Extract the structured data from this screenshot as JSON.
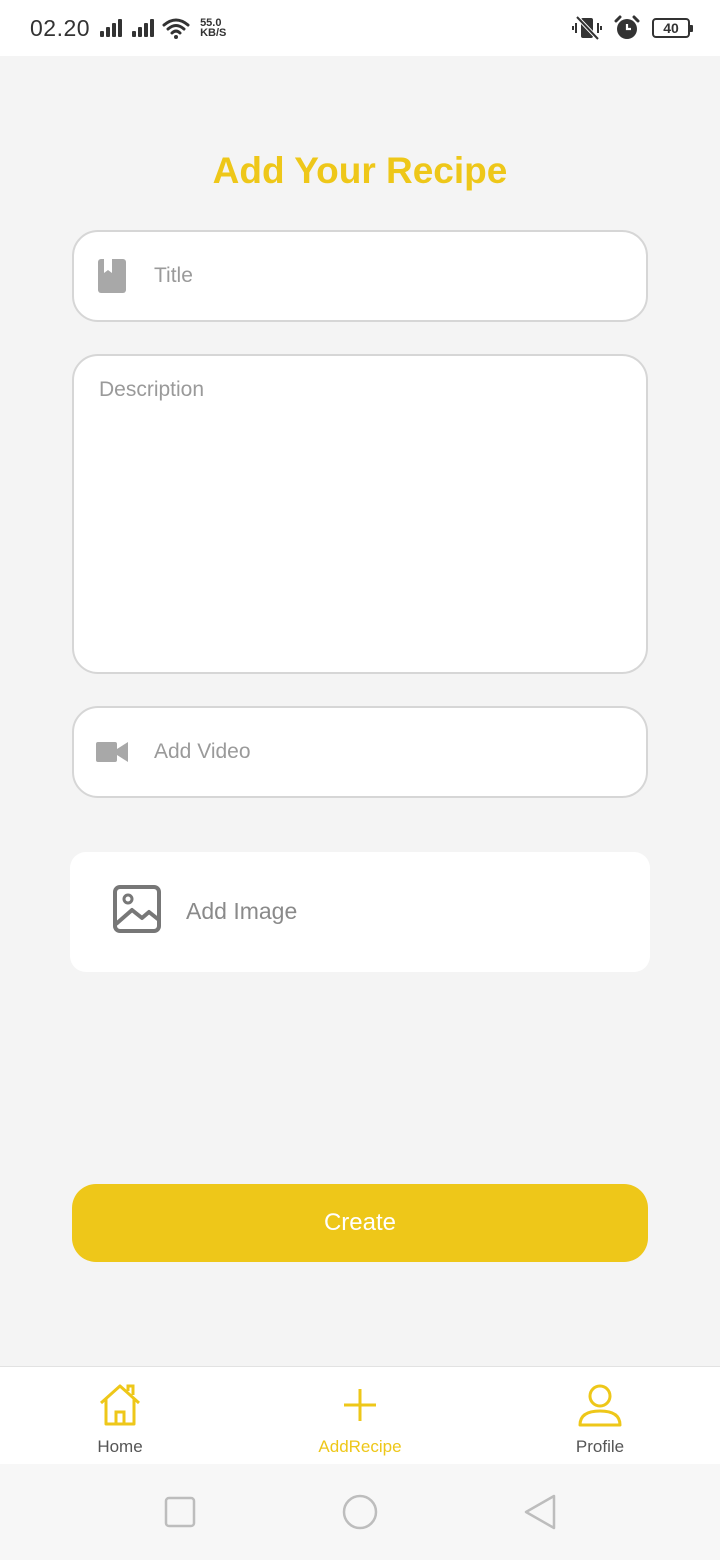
{
  "status_bar": {
    "time": "02.20",
    "speed_value": "55.0",
    "speed_unit": "KB/S",
    "battery": "40"
  },
  "page": {
    "title": "Add Your Recipe"
  },
  "form": {
    "title_placeholder": "Title",
    "description_placeholder": "Description",
    "video_placeholder": "Add Video",
    "image_label": "Add Image",
    "create_label": "Create"
  },
  "bottom_nav": {
    "items": [
      {
        "label": "Home",
        "icon": "home-icon"
      },
      {
        "label": "AddRecipe",
        "icon": "plus-icon"
      },
      {
        "label": "Profile",
        "icon": "user-icon"
      }
    ],
    "active": "AddRecipe"
  },
  "colors": {
    "accent": "#eec719",
    "background": "#f4f4f4",
    "placeholder": "#9a9a9a"
  }
}
